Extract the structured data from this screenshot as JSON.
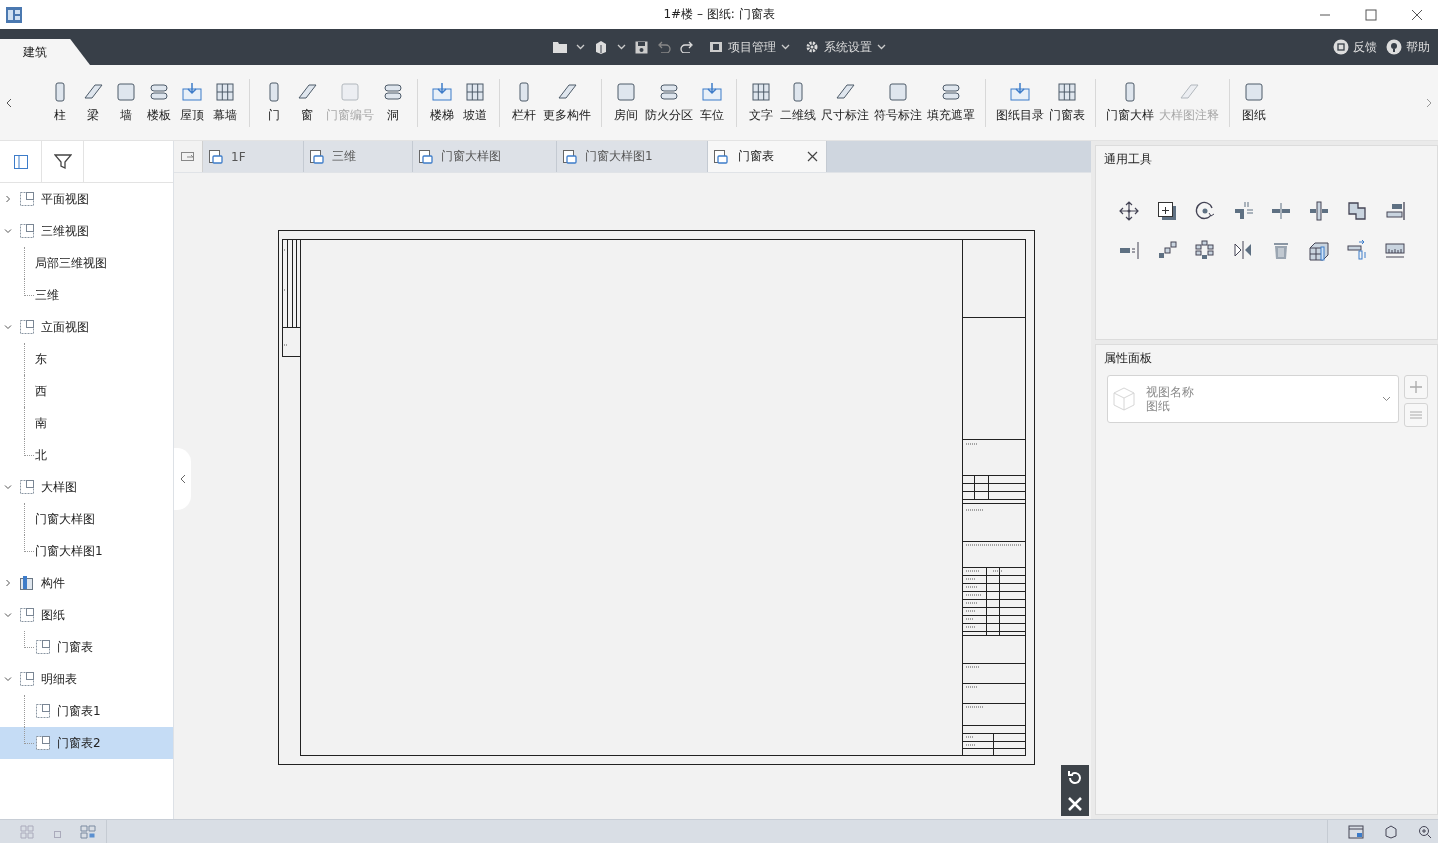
{
  "window": {
    "title": "1#楼 – 图纸: 门窗表"
  },
  "ribbon_tabs": [
    {
      "label": "建筑",
      "selected": true
    }
  ],
  "menus": [
    {
      "label": "项目管理"
    },
    {
      "label": "系统设置"
    }
  ],
  "help_links": [
    {
      "label": "反馈"
    },
    {
      "label": "帮助"
    }
  ],
  "ribbon_groups": [
    [
      {
        "label": "柱",
        "disabled": false
      },
      {
        "label": "梁",
        "disabled": false
      },
      {
        "label": "墙",
        "disabled": false
      },
      {
        "label": "楼板",
        "disabled": false
      },
      {
        "label": "屋顶",
        "disabled": false
      },
      {
        "label": "幕墙",
        "disabled": false
      }
    ],
    [
      {
        "label": "门",
        "disabled": false
      },
      {
        "label": "窗",
        "disabled": false
      },
      {
        "label": "门窗编号",
        "disabled": true
      },
      {
        "label": "洞",
        "disabled": false
      }
    ],
    [
      {
        "label": "楼梯",
        "disabled": false
      },
      {
        "label": "坡道",
        "disabled": false
      }
    ],
    [
      {
        "label": "栏杆",
        "disabled": false
      },
      {
        "label": "更多构件",
        "disabled": false
      }
    ],
    [
      {
        "label": "房间",
        "disabled": false
      },
      {
        "label": "防火分区",
        "disabled": false
      },
      {
        "label": "车位",
        "disabled": false
      }
    ],
    [
      {
        "label": "文字",
        "disabled": false
      },
      {
        "label": "二维线",
        "disabled": false
      },
      {
        "label": "尺寸标注",
        "disabled": false
      },
      {
        "label": "符号标注",
        "disabled": false
      },
      {
        "label": "填充遮罩",
        "disabled": false
      }
    ],
    [
      {
        "label": "图纸目录",
        "disabled": false
      },
      {
        "label": "门窗表",
        "disabled": false
      }
    ],
    [
      {
        "label": "门窗大样",
        "disabled": false
      },
      {
        "label": "大样图注释",
        "disabled": true
      }
    ],
    [
      {
        "label": "图纸",
        "disabled": false
      }
    ]
  ],
  "tree": [
    {
      "label": "平面视图",
      "kind": "group",
      "expanded": false,
      "selected": false
    },
    {
      "label": "三维视图",
      "kind": "group",
      "expanded": true,
      "selected": false,
      "children": [
        {
          "label": "局部三维视图",
          "kind": "leaf",
          "selected": false
        },
        {
          "label": "三维",
          "kind": "leaf",
          "selected": false
        }
      ]
    },
    {
      "label": "立面视图",
      "kind": "group",
      "expanded": true,
      "selected": false,
      "children": [
        {
          "label": "东",
          "kind": "leaf",
          "selected": false
        },
        {
          "label": "西",
          "kind": "leaf",
          "selected": false
        },
        {
          "label": "南",
          "kind": "leaf",
          "selected": false
        },
        {
          "label": "北",
          "kind": "leaf",
          "selected": false
        }
      ]
    },
    {
      "label": "大样图",
      "kind": "group",
      "expanded": true,
      "selected": false,
      "children": [
        {
          "label": "门窗大样图",
          "kind": "leaf",
          "selected": false
        },
        {
          "label": "门窗大样图1",
          "kind": "leaf",
          "selected": false
        }
      ]
    },
    {
      "label": "构件",
      "kind": "component",
      "expanded": false,
      "selected": false
    },
    {
      "label": "图纸",
      "kind": "group",
      "expanded": true,
      "selected": false,
      "children": [
        {
          "label": "门窗表",
          "kind": "sheet",
          "selected": false
        }
      ]
    },
    {
      "label": "明细表",
      "kind": "group",
      "expanded": true,
      "selected": false,
      "children": [
        {
          "label": "门窗表1",
          "kind": "sheet",
          "selected": false
        },
        {
          "label": "门窗表2",
          "kind": "sheet",
          "selected": true
        }
      ]
    }
  ],
  "doc_tabs": [
    {
      "label": "1F",
      "selected": false
    },
    {
      "label": "三维",
      "selected": false
    },
    {
      "label": "门窗大样图",
      "selected": false
    },
    {
      "label": "门窗大样图1",
      "selected": false
    },
    {
      "label": "门窗表",
      "selected": true
    }
  ],
  "tools_panel": {
    "title": "通用工具"
  },
  "properties_panel": {
    "title": "属性面板",
    "selector": {
      "line1": "视图名称",
      "line2": "图纸"
    }
  }
}
